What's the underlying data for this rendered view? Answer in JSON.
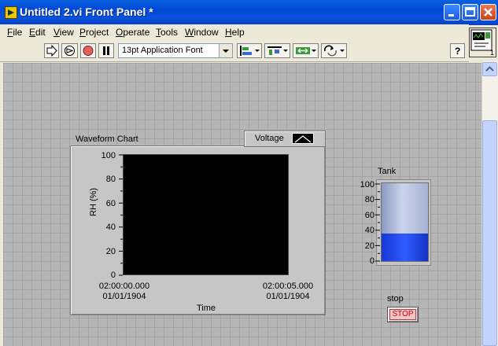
{
  "window": {
    "title": "Untitled 2.vi Front Panel *",
    "accent": "#0a52dd",
    "buttons": [
      "minimize-icon",
      "maximize-icon",
      "close-icon"
    ]
  },
  "menu": {
    "items": [
      {
        "label": "File",
        "accel": "F",
        "rest": "ile"
      },
      {
        "label": "Edit",
        "accel": "E",
        "rest": "dit"
      },
      {
        "label": "View",
        "accel": "V",
        "rest": "iew"
      },
      {
        "label": "Project",
        "accel": "P",
        "rest": "roject"
      },
      {
        "label": "Operate",
        "accel": "O",
        "rest": "perate"
      },
      {
        "label": "Tools",
        "accel": "T",
        "rest": "ools"
      },
      {
        "label": "Window",
        "accel": "W",
        "rest": "indow"
      },
      {
        "label": "Help",
        "accel": "H",
        "rest": "elp"
      }
    ]
  },
  "toolbar": {
    "font_select": "13pt Application Font",
    "icons": [
      "run-arrow-icon",
      "run-continuously-icon",
      "abort-icon",
      "pause-icon",
      "align-objects-icon",
      "distribute-objects-icon",
      "resize-objects-icon",
      "reorder-icon",
      "help-icon"
    ]
  },
  "front_panel": {
    "background": "#b6b6b6",
    "waveform_chart": {
      "label": "Waveform Chart",
      "legend": "Voltage",
      "ylabel": "RH (%)",
      "yticks": [
        "100",
        "80",
        "60",
        "40",
        "20",
        "0"
      ],
      "xlabel": "Time",
      "xticks": [
        {
          "time": "02:00:00.000",
          "date": "01/01/1904"
        },
        {
          "time": "02:00:05.000",
          "date": "01/01/1904"
        }
      ],
      "plot_background": "#000000"
    },
    "tank": {
      "label": "Tank",
      "ticks": [
        "100",
        "80",
        "60",
        "40",
        "20",
        "0"
      ],
      "value": 35,
      "max": 100,
      "fill_color": "#2f5cff"
    },
    "stop": {
      "label": "stop",
      "button_text": "STOP",
      "text_color": "#d00000"
    }
  }
}
